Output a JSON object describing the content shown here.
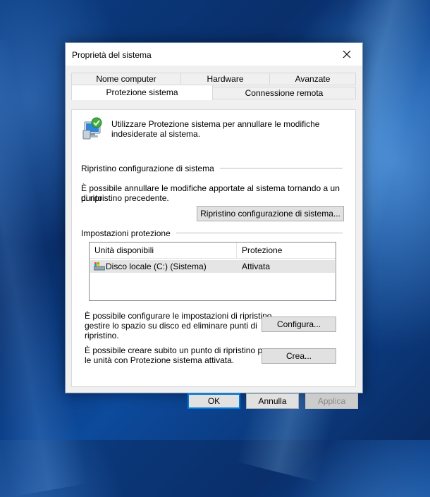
{
  "window": {
    "title": "Proprietà del sistema"
  },
  "tabs": {
    "row1": [
      "Nome computer",
      "Hardware",
      "Avanzate"
    ],
    "row2": [
      "Protezione sistema",
      "Connessione remota"
    ],
    "active": "Protezione sistema"
  },
  "intro": {
    "text_line1": "Utilizzare Protezione sistema per annullare le modifiche",
    "text_line2": "indesiderate al sistema."
  },
  "restore": {
    "group_label": "Ripristino configurazione di sistema",
    "desc_line1": "È possibile annullare le modifiche apportate al sistema tornando a un punto",
    "desc_line2": "di ripristino precedente.",
    "button": "Ripristino configurazione di sistema..."
  },
  "protection": {
    "group_label": "Impostazioni protezione",
    "columns": [
      "Unità disponibili",
      "Protezione"
    ],
    "rows": [
      {
        "drive": "Disco locale (C:) (Sistema)",
        "status": "Attivata"
      }
    ],
    "configure_line1": "È possibile configurare le impostazioni di ripristino,",
    "configure_line2": "gestire lo spazio su disco ed eliminare punti di",
    "configure_line3": "ripristino.",
    "configure_button": "Configura...",
    "create_line1": "È possibile creare subito un punto di ripristino per",
    "create_line2": "le unità con Protezione sistema attivata.",
    "create_button": "Crea..."
  },
  "footer": {
    "ok": "OK",
    "cancel": "Annulla",
    "apply": "Applica"
  }
}
